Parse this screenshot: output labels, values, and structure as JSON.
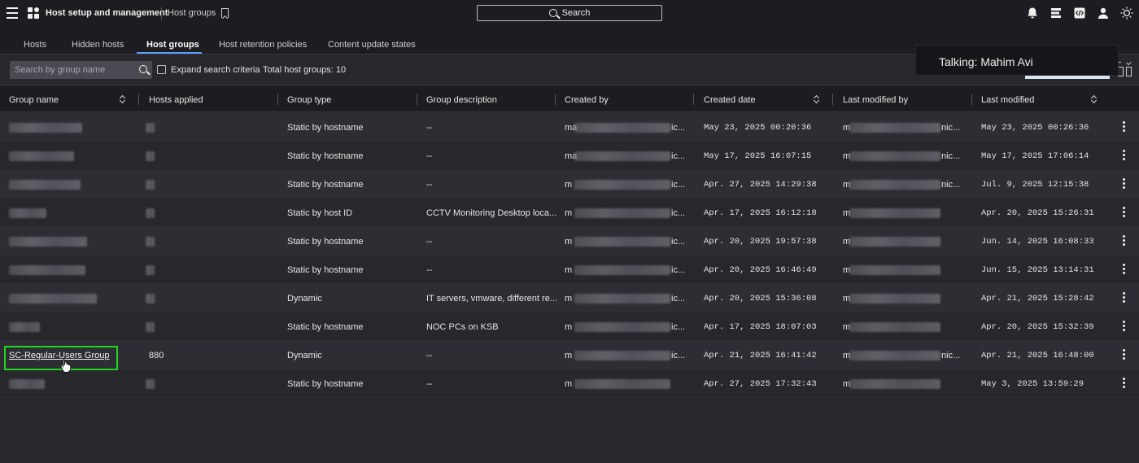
{
  "header": {
    "app_title": "Host setup and management",
    "breadcrumb": "Host groups",
    "search_label": "Search"
  },
  "tabs": [
    {
      "label": "Hosts"
    },
    {
      "label": "Hidden hosts"
    },
    {
      "label": "Host groups"
    },
    {
      "label": "Host retention policies"
    },
    {
      "label": "Content update states"
    }
  ],
  "active_tab": "Host groups",
  "filter": {
    "search_placeholder": "Search by group name",
    "expand_label": "Expand search criteria",
    "total_label": "Total host groups: 10"
  },
  "overlay": {
    "talking": "Talking: Mahim Avi"
  },
  "table": {
    "columns": [
      "Group name",
      "Hosts applied",
      "Group type",
      "Group description",
      "Created by",
      "Created date",
      "Last modified by",
      "Last modified"
    ],
    "rows": [
      {
        "name": "",
        "hosts": "",
        "type": "Static by hostname",
        "description": "--",
        "created_by_prefix": "ma",
        "created_by_suffix": "ic...",
        "created_date": "May 23, 2025 00:20:36",
        "modified_by_prefix": "m",
        "modified_by_suffix": "nic...",
        "modified": "May 23, 2025 00:26:36"
      },
      {
        "name": "",
        "hosts": "",
        "type": "Static by hostname",
        "description": "--",
        "created_by_prefix": "ma",
        "created_by_suffix": "ic...",
        "created_date": "May 17, 2025 16:07:15",
        "modified_by_prefix": "m",
        "modified_by_suffix": "nic...",
        "modified": "May 17, 2025 17:06:14"
      },
      {
        "name": "",
        "hosts": "",
        "type": "Static by hostname",
        "description": "--",
        "created_by_prefix": "m",
        "created_by_suffix": "ic...",
        "created_date": "Apr. 27, 2025 14:29:38",
        "modified_by_prefix": "m",
        "modified_by_suffix": "nic...",
        "modified": "Jul. 9, 2025 12:15:38"
      },
      {
        "name": "",
        "hosts": "",
        "type": "Static by host ID",
        "description": "CCTV Monitoring Desktop loca...",
        "created_by_prefix": "m",
        "created_by_suffix": "ic...",
        "created_date": "Apr. 17, 2025 16:12:18",
        "modified_by_prefix": "m",
        "modified_by_suffix": "",
        "modified": "Apr. 20, 2025 15:26:31"
      },
      {
        "name": "",
        "hosts": "",
        "type": "Static by hostname",
        "description": "--",
        "created_by_prefix": "m",
        "created_by_suffix": "ic...",
        "created_date": "Apr. 20, 2025 19:57:38",
        "modified_by_prefix": "m",
        "modified_by_suffix": "",
        "modified": "Jun. 14, 2025 16:08:33"
      },
      {
        "name": "",
        "hosts": "",
        "type": "Static by hostname",
        "description": "--",
        "created_by_prefix": "m",
        "created_by_suffix": "ic...",
        "created_date": "Apr. 20, 2025 16:46:49",
        "modified_by_prefix": "m",
        "modified_by_suffix": "",
        "modified": "Jun. 15, 2025 13:14:31"
      },
      {
        "name": "",
        "hosts": "",
        "type": "Dynamic",
        "description": "IT servers, vmware, different re...",
        "created_by_prefix": "m",
        "created_by_suffix": "ic...",
        "created_date": "Apr. 20, 2025 15:36:08",
        "modified_by_prefix": "m",
        "modified_by_suffix": "",
        "modified": "Apr. 21, 2025 15:28:42"
      },
      {
        "name": "",
        "hosts": "",
        "type": "Static by hostname",
        "description": "NOC PCs on KSB",
        "created_by_prefix": "m",
        "created_by_suffix": "ic...",
        "created_date": "Apr. 17, 2025 18:07:03",
        "modified_by_prefix": "m",
        "modified_by_suffix": "",
        "modified": "Apr. 20, 2025 15:32:39"
      },
      {
        "name": "SC-Regular-Users Group",
        "hosts": "880",
        "type": "Dynamic",
        "description": "--",
        "created_by_prefix": "m",
        "created_by_suffix": "ic...",
        "created_date": "Apr. 21, 2025 16:41:42",
        "modified_by_prefix": "m",
        "modified_by_suffix": "nic...",
        "modified": "Apr. 21, 2025 16:48:00"
      },
      {
        "name": "",
        "hosts": "",
        "type": "Static by hostname",
        "description": "--",
        "created_by_prefix": "m",
        "created_by_suffix": "",
        "created_date": "Apr. 27, 2025 17:32:43",
        "modified_by_prefix": "m",
        "modified_by_suffix": "",
        "modified": "May 3, 2025 13:59:29"
      }
    ]
  }
}
